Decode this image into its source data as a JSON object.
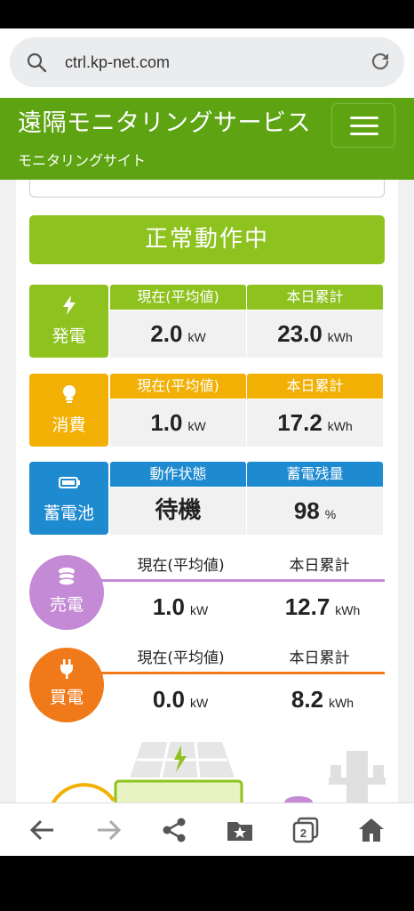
{
  "browser": {
    "url": "ctrl.kp-net.com"
  },
  "header": {
    "title": "遠隔モニタリングサービス",
    "subtitle": "モニタリングサイト"
  },
  "status": {
    "text": "正常動作中"
  },
  "generation": {
    "label": "発電",
    "col1_header": "現在(平均値)",
    "col1_value": "2.0",
    "col1_unit": "kW",
    "col2_header": "本日累計",
    "col2_value": "23.0",
    "col2_unit": "kWh",
    "color": "#8dc21f"
  },
  "consumption": {
    "label": "消費",
    "col1_header": "現在(平均値)",
    "col1_value": "1.0",
    "col1_unit": "kW",
    "col2_header": "本日累計",
    "col2_value": "17.2",
    "col2_unit": "kWh",
    "color": "#f2b005"
  },
  "battery": {
    "label": "蓄電池",
    "col1_header": "動作状態",
    "col1_value": "待機",
    "col2_header": "蓄電残量",
    "col2_value": "98",
    "col2_unit": "%",
    "color": "#1e8ad0"
  },
  "sell": {
    "label": "売電",
    "col1_header": "現在(平均値)",
    "col1_value": "1.0",
    "col1_unit": "kW",
    "col2_header": "本日累計",
    "col2_value": "12.7",
    "col2_unit": "kWh",
    "color": "#c48ad6"
  },
  "buy": {
    "label": "買電",
    "col1_header": "現在(平均値)",
    "col1_value": "0.0",
    "col1_unit": "kW",
    "col2_header": "本日累計",
    "col2_value": "8.2",
    "col2_unit": "kWh",
    "color": "#f07a1a"
  },
  "nav": {
    "tab_count": "2"
  },
  "icons": {
    "search": "search-icon",
    "reload": "reload-icon",
    "menu": "hamburger-menu-icon",
    "generation": "lightning-icon",
    "consumption": "lightbulb-icon",
    "battery": "battery-icon",
    "sell": "coins-icon",
    "buy": "plug-icon",
    "back": "back-arrow-icon",
    "forward": "forward-arrow-icon",
    "share": "share-icon",
    "bookmarks": "bookmark-folder-icon",
    "tabs": "tabs-icon",
    "home": "home-icon"
  }
}
